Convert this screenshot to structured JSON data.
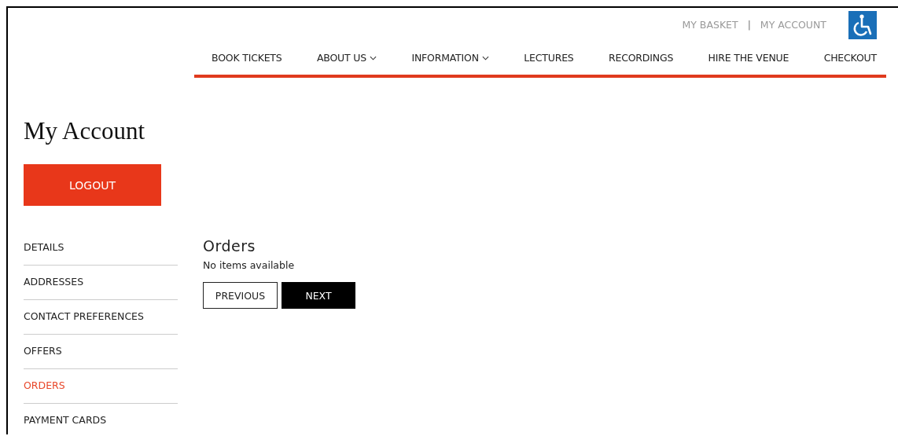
{
  "utility_links": [
    {
      "label": "MY BASKET"
    },
    {
      "label": "MY ACCOUNT"
    }
  ],
  "utility_separator": "|",
  "nav": [
    {
      "label": "BOOK TICKETS",
      "dropdown": false
    },
    {
      "label": "ABOUT US",
      "dropdown": true
    },
    {
      "label": "INFORMATION",
      "dropdown": true
    },
    {
      "label": "LECTURES",
      "dropdown": false
    },
    {
      "label": "RECORDINGS",
      "dropdown": false
    },
    {
      "label": "HIRE THE VENUE",
      "dropdown": false
    },
    {
      "label": "CHECKOUT",
      "dropdown": false
    }
  ],
  "page_title": "My Account",
  "logout_button": "LOGOUT",
  "sidebar": {
    "items": [
      {
        "label": "DETAILS",
        "selected": false
      },
      {
        "label": "ADDRESSES",
        "selected": false
      },
      {
        "label": "CONTACT PREFERENCES",
        "selected": false
      },
      {
        "label": "OFFERS",
        "selected": false
      },
      {
        "label": "ORDERS",
        "selected": true
      },
      {
        "label": "PAYMENT CARDS",
        "selected": false
      }
    ]
  },
  "orders": {
    "title": "Orders",
    "message": "No items available",
    "buttons": [
      {
        "label": "PREVIOUS",
        "kind": "outline"
      },
      {
        "label": "NEXT",
        "kind": "solid"
      }
    ]
  }
}
